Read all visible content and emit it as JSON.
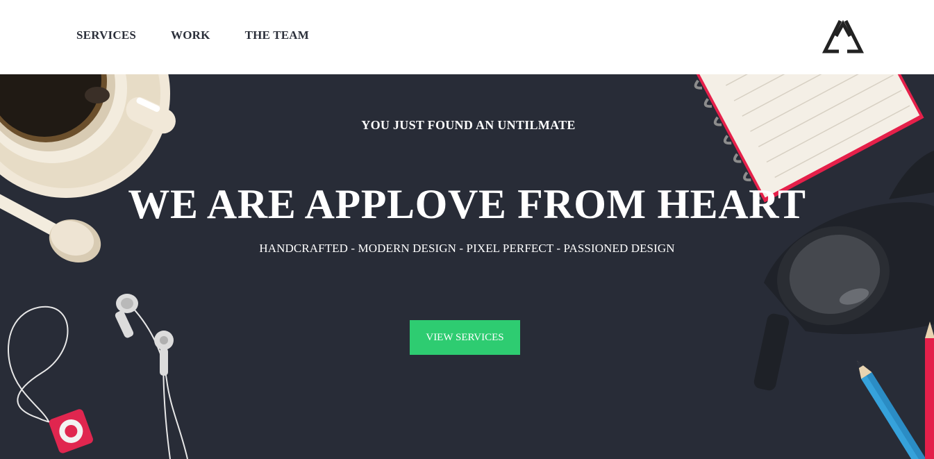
{
  "nav": {
    "items": [
      {
        "label": "SERVICES"
      },
      {
        "label": "WORK"
      },
      {
        "label": "THE TEAM"
      }
    ]
  },
  "logo": {
    "icon": "triangle-recycle-icon"
  },
  "hero": {
    "tagline": "YOU JUST FOUND AN UNTILMATE",
    "headline": "WE ARE APPLOVE FROM HEART",
    "subline": "HANDCRAFTED - MODERN DESIGN - PIXEL PERFECT - PASSIONED DESIGN",
    "cta_label": "VIEW SERVICES",
    "background_color": "#282c37",
    "accent_color": "#2ecc71"
  },
  "decor": {
    "icons": [
      "coffee-cup-icon",
      "spoon-icon",
      "earphones-icon",
      "music-player-icon",
      "notebook-icon",
      "glasses-icon",
      "pencil-icon"
    ]
  }
}
